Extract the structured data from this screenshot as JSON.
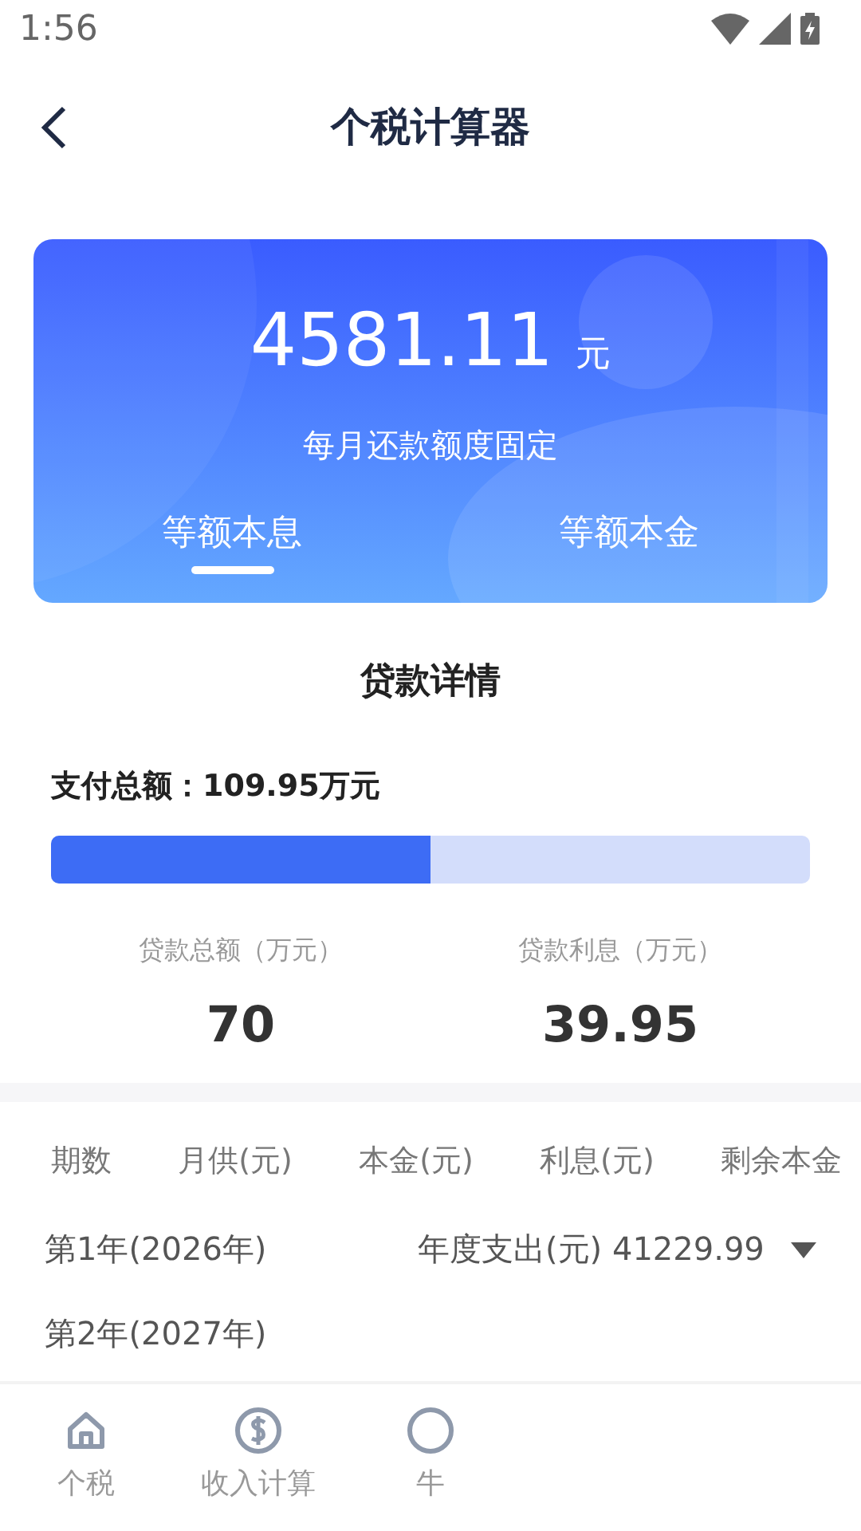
{
  "status_bar": {
    "time": "1:56"
  },
  "header": {
    "title": "个税计算器"
  },
  "summary": {
    "amount": "4581.11",
    "unit": "元",
    "note": "每月还款额度固定",
    "tabs": [
      {
        "label": "等额本息",
        "selected": true
      },
      {
        "label": "等额本金",
        "selected": false
      }
    ]
  },
  "loan_detail": {
    "title": "贷款详情",
    "total_label": "支付总额：",
    "total_value": "109.95万元",
    "level": 0.5,
    "stats": [
      {
        "label": "贷款总额（万元）",
        "value": "70"
      },
      {
        "label": "贷款利息（万元）",
        "value": "39.95"
      }
    ]
  },
  "table": {
    "columns": [
      "期数",
      "月供(元)",
      "本金(元)",
      "利息(元)",
      "剩余本金"
    ],
    "rows": [
      {
        "period": "第1年(2026年)",
        "annual": "年度支出(元) 41229.99"
      },
      {
        "period": "第2年(2027年)"
      }
    ]
  },
  "tab_bar": {
    "items": [
      {
        "label": "个税",
        "kind": "home",
        "selected": false
      },
      {
        "label": "收入计算",
        "kind": "dollar",
        "selected": false
      },
      {
        "label": "牛",
        "kind": "circle",
        "selected": false
      }
    ]
  }
}
